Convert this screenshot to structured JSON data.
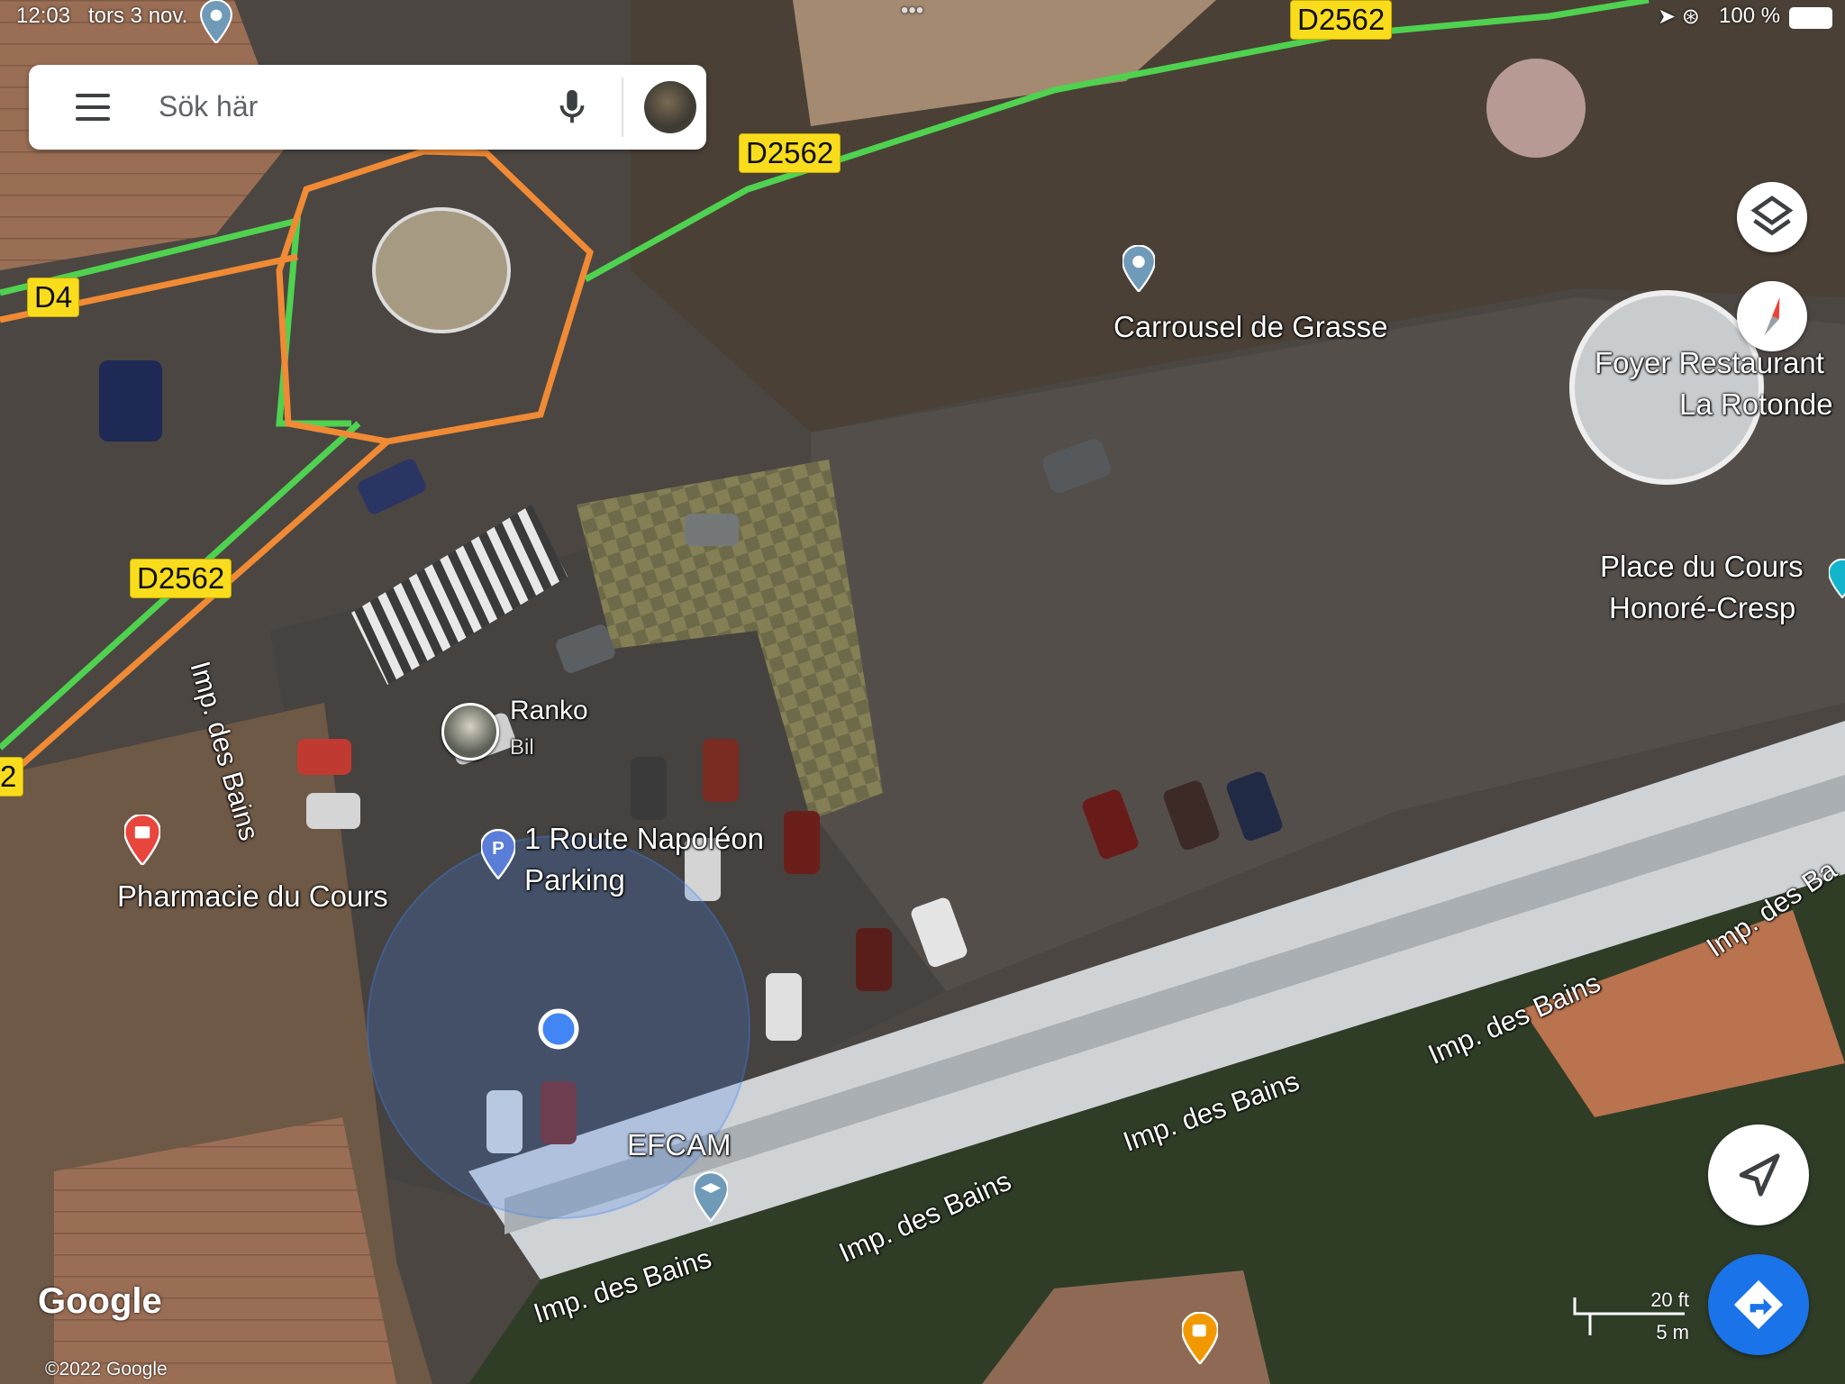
{
  "status_bar": {
    "time": "12:03",
    "date": "tors 3 nov.",
    "battery": "100 %"
  },
  "search": {
    "placeholder": "Sök här"
  },
  "road_shields": [
    "D2562",
    "D2562",
    "D2562",
    "D4",
    "2"
  ],
  "places": {
    "carrousel": "Carrousel de Grasse",
    "foyer_line1": "Foyer Restaurant",
    "foyer_line2": "La Rotonde",
    "place_line1": "Place du Cours",
    "place_line2": "Honoré-Cresp",
    "pharmacie": "Pharmacie du Cours",
    "parking_line1": "1 Route Napoléon",
    "parking_line2": "Parking",
    "efcam": "EFCAM",
    "contact_name": "Ranko",
    "contact_sub": "Bil"
  },
  "streets": [
    "Imp. des Bains",
    "Imp. des Bains",
    "Imp. des Bains",
    "Imp. des Bains",
    "Imp. des Bains",
    "Imp. des Ba"
  ],
  "attribution": {
    "logo": "Google",
    "copyright": "©2022 Google"
  },
  "scale_bar": {
    "imperial": "20 ft",
    "metric": "5 m"
  },
  "colors": {
    "route_green": "#4fd24f",
    "route_orange": "#f08a34",
    "shield_yellow": "#f9dc1c",
    "location_blue": "#4285f4",
    "directions_fab": "#1a73e8"
  },
  "icons": [
    "menu-icon",
    "mic-icon",
    "layers-icon",
    "compass-icon",
    "my-location-icon",
    "directions-icon",
    "map-pin-icon",
    "parking-icon",
    "pharmacy-icon",
    "school-icon",
    "cafe-icon"
  ]
}
